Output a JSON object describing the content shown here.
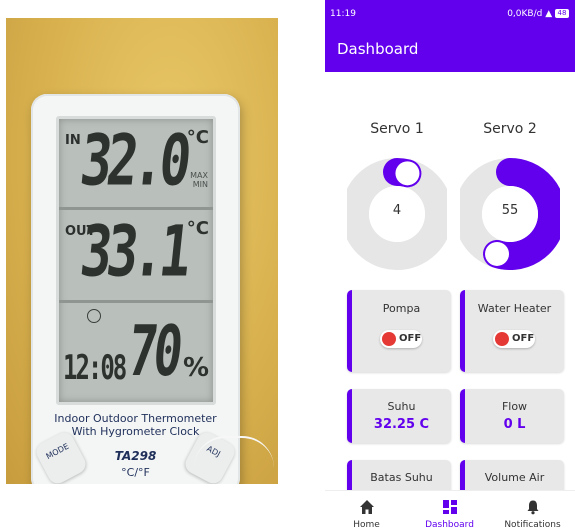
{
  "photo": {
    "in_label": "IN",
    "in_temp": "32.0",
    "in_unit": "°C",
    "out_label": "OUT",
    "out_temp": "33.1",
    "out_unit": "°C",
    "maxmin": "MAX\nMIN",
    "clock": "12:08",
    "humidity": "70",
    "humidity_unit": "%",
    "label_line1": "Indoor Outdoor Thermometer",
    "label_line2": "With Hygrometer Clock",
    "model": "TA298",
    "unit_button": "°C/°F",
    "mode_button": "MODE",
    "adj_button": "ADJ"
  },
  "status_bar": {
    "time": "11:19",
    "network": "0,0KB/d",
    "battery": "48"
  },
  "app_bar": {
    "title": "Dashboard"
  },
  "colors": {
    "accent": "#6200ee",
    "track": "#e6e6e6",
    "off": "#e53935"
  },
  "servos": [
    {
      "title": "Servo 1",
      "value": "4",
      "percent": 4
    },
    {
      "title": "Servo 2",
      "value": "55",
      "percent": 55
    }
  ],
  "cards": {
    "pompa": {
      "label": "Pompa",
      "state": "OFF"
    },
    "water_heater": {
      "label": "Water Heater",
      "state": "OFF"
    },
    "suhu": {
      "label": "Suhu",
      "value": "32.25 C"
    },
    "flow": {
      "label": "Flow",
      "value": "0 L"
    },
    "batas_suhu": {
      "label": "Batas Suhu",
      "value": ""
    },
    "volume_air": {
      "label": "Volume Air",
      "value": ""
    }
  },
  "bottom_nav": [
    {
      "label": "Home",
      "icon": "home-icon",
      "active": false
    },
    {
      "label": "Dashboard",
      "icon": "dashboard-icon",
      "active": true
    },
    {
      "label": "Notifications",
      "icon": "bell-icon",
      "active": false
    }
  ]
}
